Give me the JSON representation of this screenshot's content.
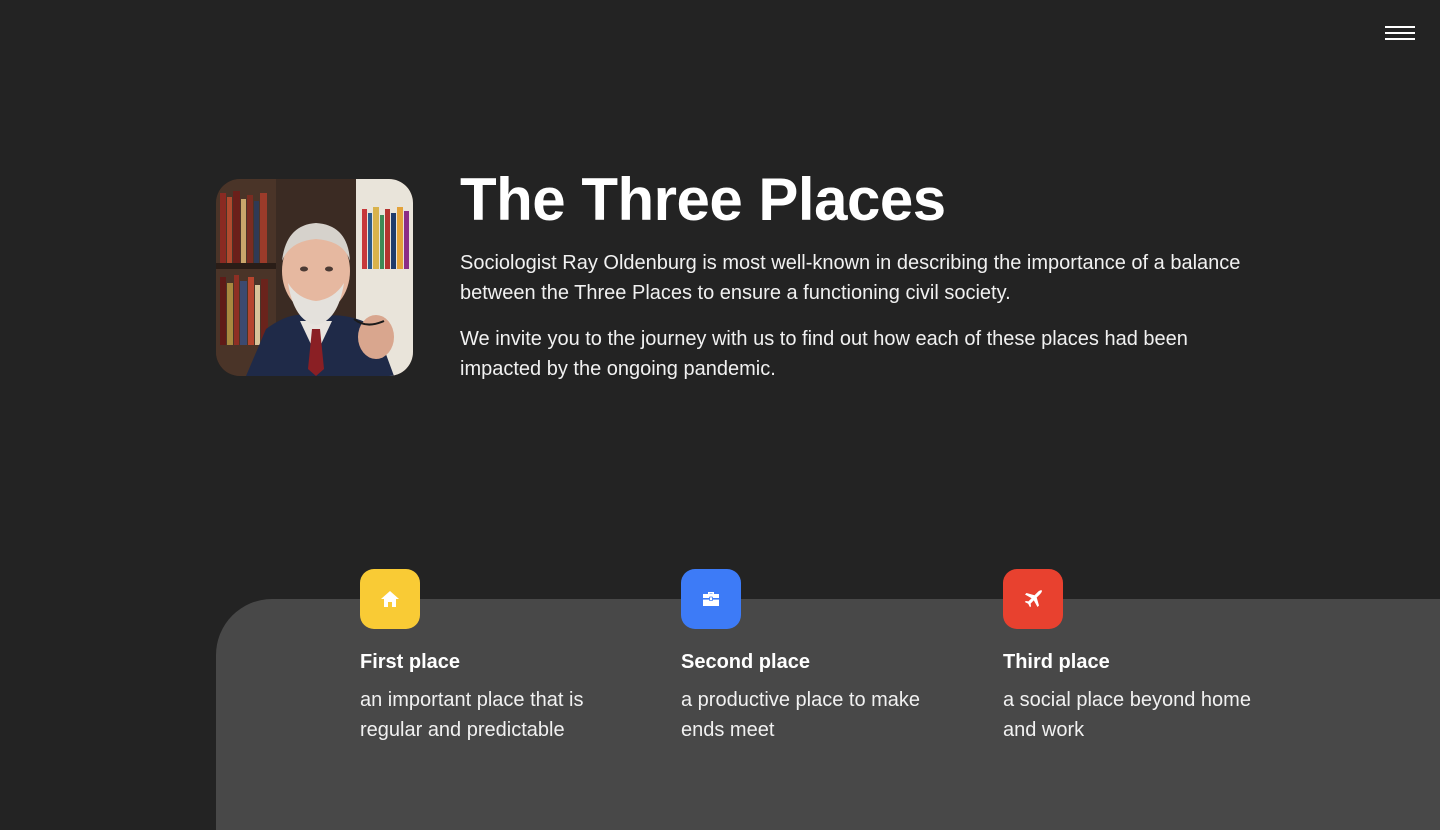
{
  "header": {
    "menu_icon": "hamburger-menu-icon"
  },
  "intro": {
    "portrait_alt": "Portrait of Ray Oldenburg",
    "title": "The Three Places",
    "paragraph_1": "Sociologist Ray Oldenburg is most well-known in describing the importance of a balance between the Three Places to ensure a functioning civil society.",
    "paragraph_2": "We invite you to the journey with us to find out how each of these places had been impacted by the ongoing pandemic."
  },
  "places": [
    {
      "icon": "home-icon",
      "color": "#F9CB35",
      "title": "First place",
      "description": "an important place that is regular and predictable"
    },
    {
      "icon": "briefcase-icon",
      "color": "#3D7BF7",
      "title": "Second place",
      "description": "a productive place to make ends meet"
    },
    {
      "icon": "airplane-icon",
      "color": "#E8412F",
      "title": "Third place",
      "description": "a social place beyond home and work"
    }
  ]
}
